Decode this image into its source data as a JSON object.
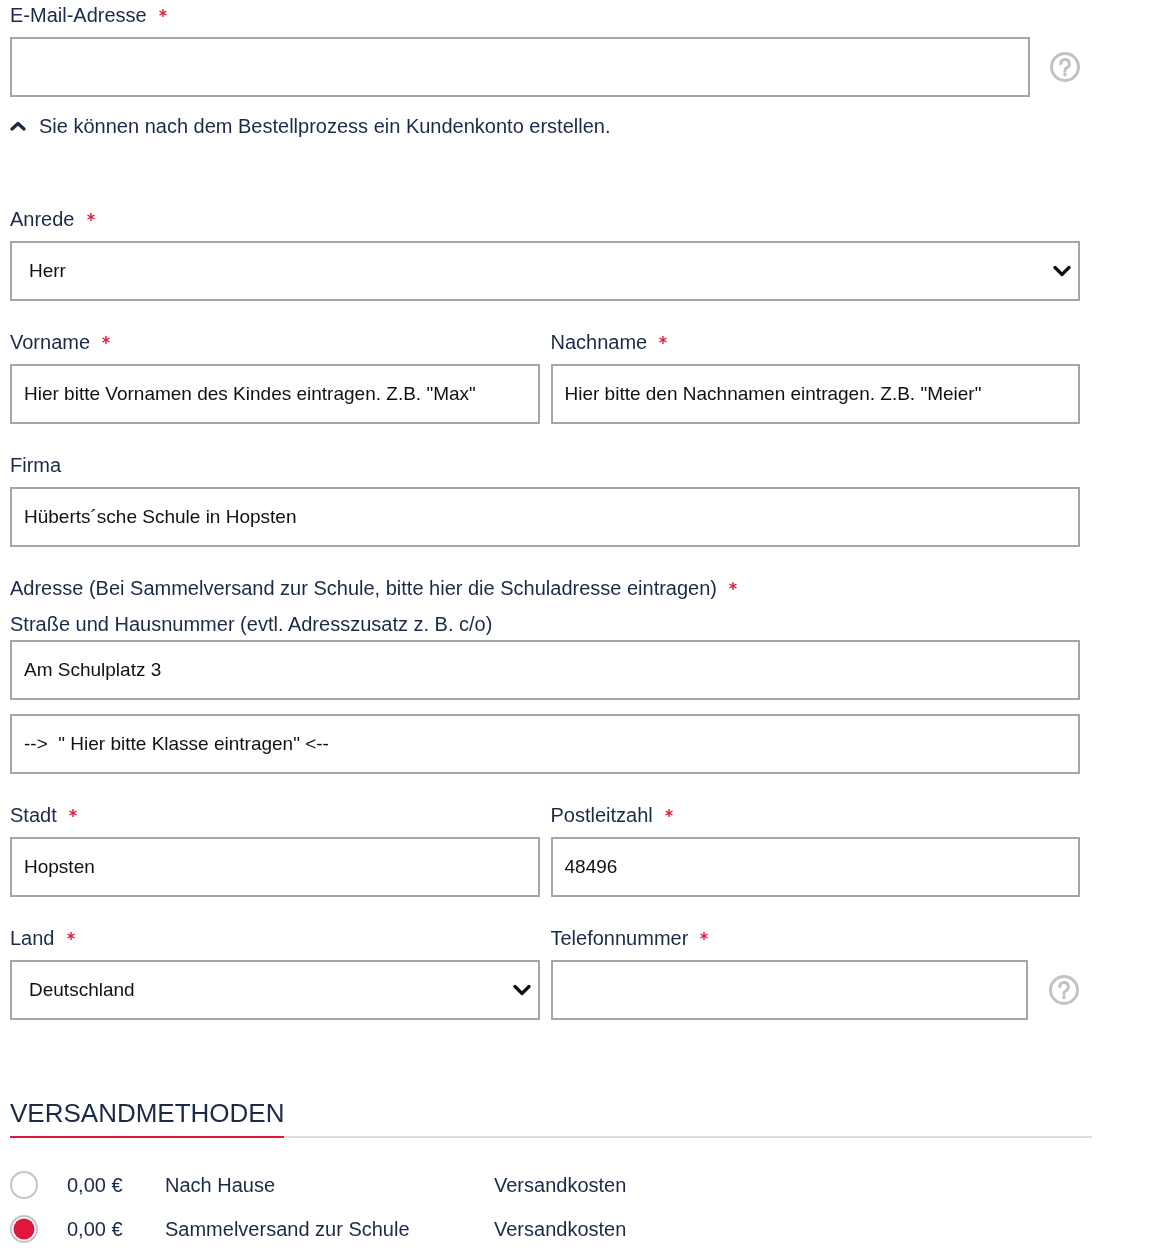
{
  "email_field": {
    "kind": "text",
    "label": "E-Mail-Adresse",
    "required": true,
    "help": true
  },
  "account_note": {
    "text": "Sie können nach dem Bestellprozess ein Kundenkonto erstellen.",
    "expanded": true
  },
  "form_rows": [
    [
      {
        "kind": "select",
        "label": "Anrede",
        "required": true,
        "help": false,
        "value": "Herr"
      }
    ],
    [
      {
        "kind": "text",
        "label": "Vorname",
        "required": true,
        "help": false,
        "value": "Hier bitte Vornamen des Kindes eintragen. Z.B. \"Max\""
      },
      {
        "kind": "text",
        "label": "Nachname",
        "required": true,
        "help": false,
        "value": "Hier bitte den Nachnamen eintragen. Z.B. \"Meier\""
      }
    ],
    [
      {
        "kind": "text",
        "label": "Firma",
        "required": false,
        "help": false,
        "value": "Hüberts´sche Schule in Hopsten"
      }
    ],
    [
      {
        "kind": "address",
        "label": "Adresse (Bei Sammelversand zur Schule, bitte hier die Schuladresse eintragen)",
        "required": true,
        "sublabel": "Straße und Hausnummer (evtl. Adresszusatz z. B. c/o)",
        "values": [
          "Am Schulplatz 3",
          "-->  \" Hier bitte Klasse eintragen\" <--"
        ]
      }
    ],
    [
      {
        "kind": "text",
        "label": "Stadt",
        "required": true,
        "help": false,
        "value": "Hopsten"
      },
      {
        "kind": "text",
        "label": "Postleitzahl",
        "required": true,
        "help": false,
        "value": "48496"
      }
    ],
    [
      {
        "kind": "select",
        "label": "Land",
        "required": true,
        "help": false,
        "value": "Deutschland"
      },
      {
        "kind": "text",
        "label": "Telefonnummer",
        "required": true,
        "help": true
      }
    ]
  ],
  "shipping": {
    "title": "VERSANDMETHODEN",
    "methods": [
      {
        "selected": false,
        "price": "0,00 €",
        "name": "Nach Hause",
        "note": "Versandkosten"
      },
      {
        "selected": true,
        "price": "0,00 €",
        "name": "Sammelversand zur Schule",
        "note": "Versandkosten"
      }
    ]
  }
}
